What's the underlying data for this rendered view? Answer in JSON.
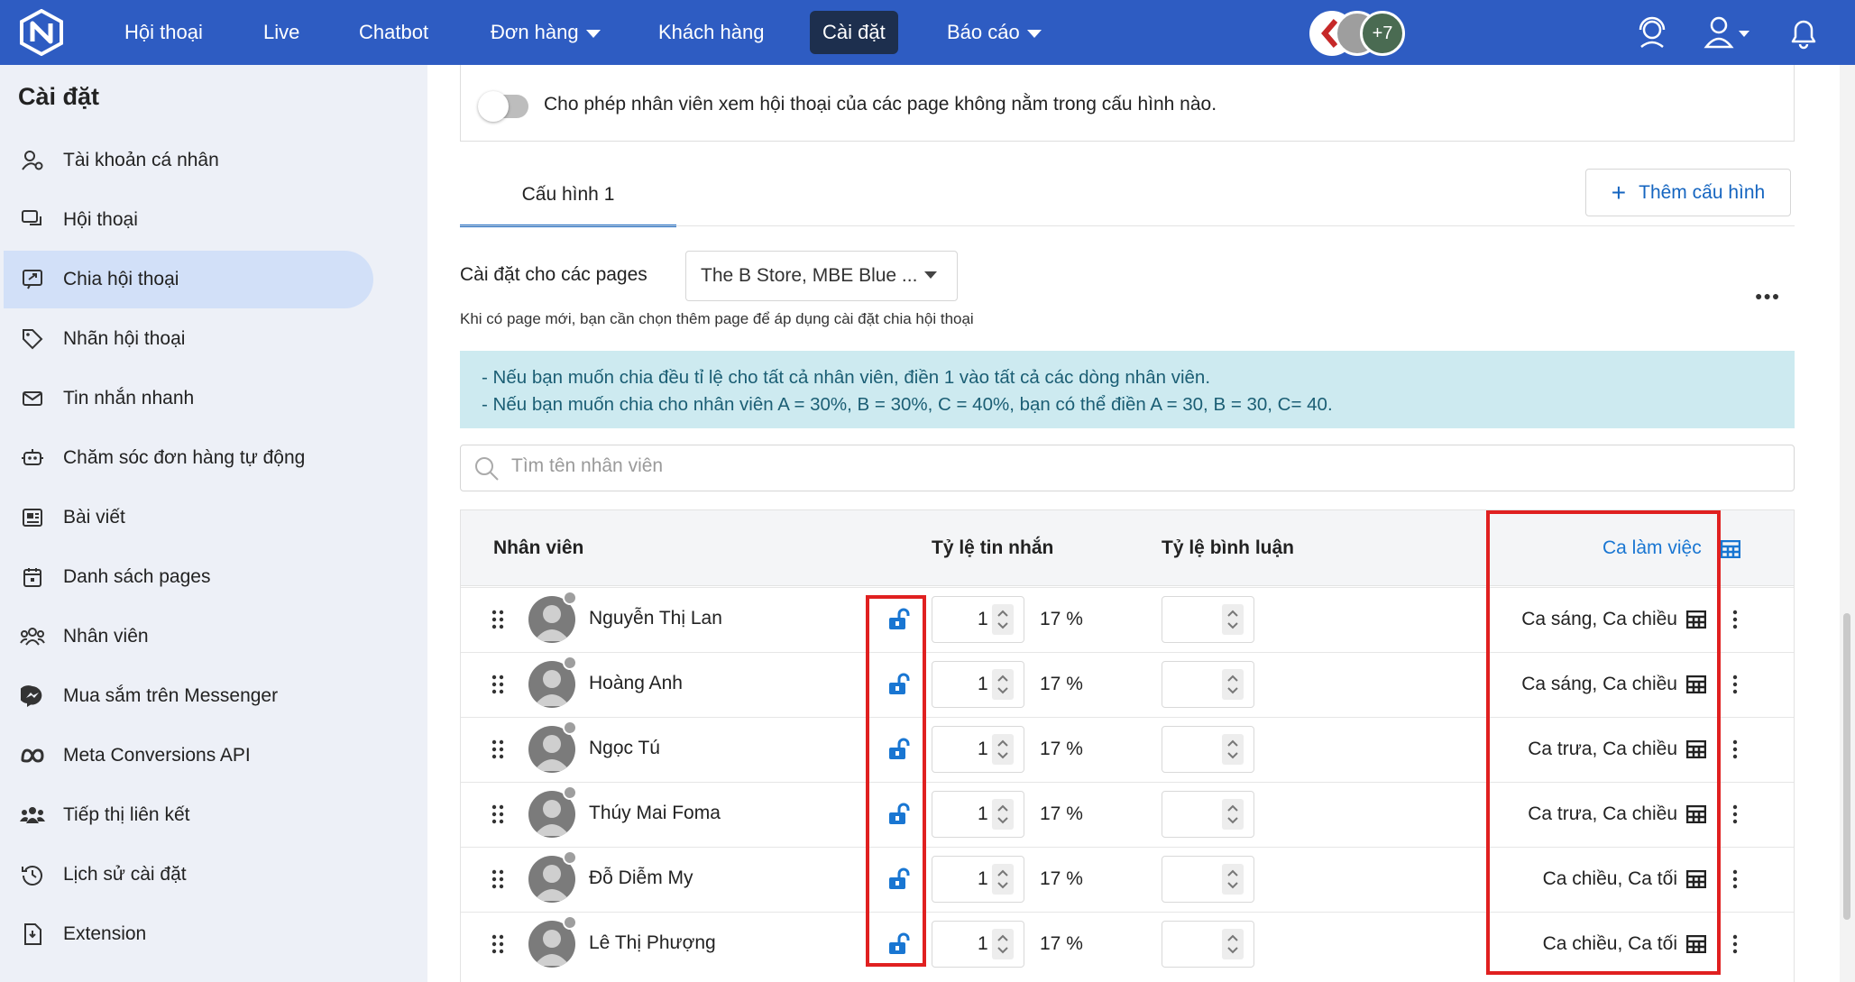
{
  "nav": {
    "items": [
      "Hội thoại",
      "Live",
      "Chatbot",
      "Đơn hàng",
      "Khách hàng",
      "Cài đặt",
      "Báo cáo"
    ],
    "active": "Cài đặt",
    "avatars_more": "+7"
  },
  "sidebar": {
    "title": "Cài đặt",
    "items": [
      {
        "label": "Tài khoản cá nhân",
        "icon": "user-gear-icon"
      },
      {
        "label": "Hội thoại",
        "icon": "chat-bubbles-icon"
      },
      {
        "label": "Chia hội thoại",
        "icon": "share-chat-icon"
      },
      {
        "label": "Nhãn hội thoại",
        "icon": "tag-icon"
      },
      {
        "label": "Tin nhắn nhanh",
        "icon": "mail-icon"
      },
      {
        "label": "Chăm sóc đơn hàng tự động",
        "icon": "robot-icon"
      },
      {
        "label": "Bài viết",
        "icon": "newspaper-icon"
      },
      {
        "label": "Danh sách pages",
        "icon": "calendar-icon"
      },
      {
        "label": "Nhân viên",
        "icon": "users-icon"
      },
      {
        "label": "Mua sắm trên Messenger",
        "icon": "messenger-icon"
      },
      {
        "label": "Meta Conversions API",
        "icon": "meta-icon"
      },
      {
        "label": "Tiếp thị liên kết",
        "icon": "group-icon"
      },
      {
        "label": "Lịch sử cài đặt",
        "icon": "history-icon"
      },
      {
        "label": "Extension",
        "icon": "extension-icon"
      }
    ],
    "active_index": 2
  },
  "settings": {
    "toggle_text": "Cho phép nhân viên xem hội thoại của các page không nằm trong cấu hình nào.",
    "toggle_on": false,
    "tab_label": "Cấu hình 1",
    "add_button": "Thêm cấu hình",
    "pages_label": "Cài đặt cho các pages",
    "pages_value": "The B Store, MBE Blue ...",
    "hint": "Khi có page mới, bạn cần chọn thêm page để áp dụng cài đặt chia hội thoại",
    "info_lines": [
      "- Nếu bạn muốn chia đều tỉ lệ cho tất cả nhân viên, điền 1 vào tất cả các dòng nhân viên.",
      "- Nếu bạn muốn chia cho nhân viên A = 30%, B = 30%, C = 40%, bạn có thể điền A = 30, B = 30, C= 40."
    ],
    "search_placeholder": "Tìm tên nhân viên"
  },
  "table": {
    "headers": {
      "staff": "Nhân viên",
      "msg_ratio": "Tỷ lệ tin nhắn",
      "comment_ratio": "Tỷ lệ bình luận",
      "shift": "Ca làm việc"
    },
    "rows": [
      {
        "name": "Nguyễn Thị Lan",
        "msg": "1",
        "pct": "17 %",
        "shift": "Ca sáng, Ca chiều"
      },
      {
        "name": "Hoàng Anh",
        "msg": "1",
        "pct": "17 %",
        "shift": "Ca sáng, Ca chiều"
      },
      {
        "name": "Ngọc Tú",
        "msg": "1",
        "pct": "17 %",
        "shift": "Ca trưa, Ca chiều"
      },
      {
        "name": "Thúy Mai Foma",
        "msg": "1",
        "pct": "17 %",
        "shift": "Ca trưa, Ca chiều"
      },
      {
        "name": "Đỗ Diễm My",
        "msg": "1",
        "pct": "17 %",
        "shift": "Ca chiều, Ca tối"
      },
      {
        "name": "Lê Thị Phượng",
        "msg": "1",
        "pct": "17 %",
        "shift": "Ca chiều, Ca tối"
      }
    ]
  },
  "colors": {
    "nav": "#2e5cc2",
    "accent": "#1976d2",
    "highlight": "#e02020",
    "info_bg": "#cdeaf0"
  }
}
